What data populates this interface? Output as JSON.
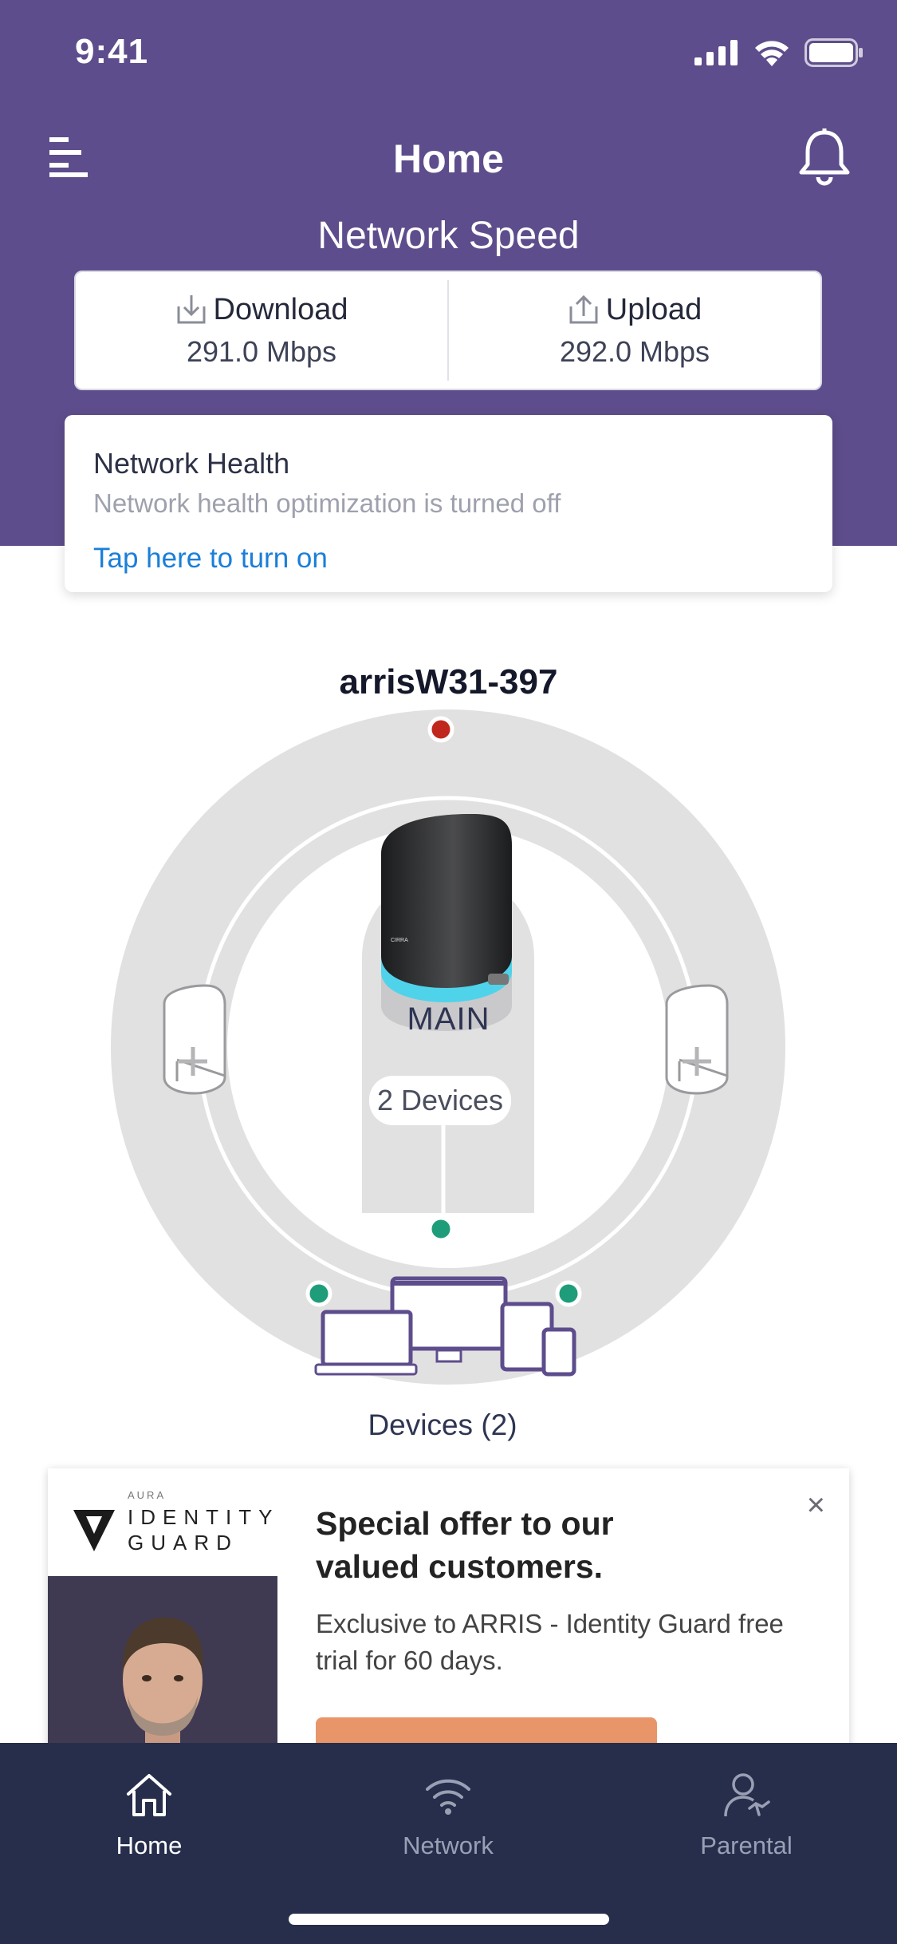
{
  "status_bar": {
    "time": "9:41"
  },
  "header": {
    "title": "Home"
  },
  "speed": {
    "heading": "Network Speed",
    "download_label": "Download",
    "download_value": "291.0 Mbps",
    "upload_label": "Upload",
    "upload_value": "292.0 Mbps"
  },
  "health": {
    "title": "Network Health",
    "subtitle": "Network health optimization is turned off",
    "link": "Tap here to turn on"
  },
  "network": {
    "name": "arrisW31-397",
    "main_label": "MAIN",
    "devices_pill": "2 Devices",
    "devices_label": "Devices (2)"
  },
  "ad": {
    "aura": "AURA",
    "brand_line1": "IDENTITY",
    "brand_line2": "GUARD",
    "title": "Special offer to our valued customers.",
    "text": "Exclusive to ARRIS - Identity Guard free trial for 60 days."
  },
  "tabs": [
    {
      "label": "Home",
      "icon": "home-icon",
      "active": true
    },
    {
      "label": "Network",
      "icon": "wifi-icon",
      "active": false
    },
    {
      "label": "Parental",
      "icon": "parental-icon",
      "active": false
    }
  ],
  "colors": {
    "header_bg": "#5e4d8c",
    "link": "#1a7fd8",
    "tabbar_bg": "#262e4c",
    "status_dot_main": "#c0281d",
    "status_dot_device": "#1f9c7a",
    "cta": "#e9956a"
  }
}
